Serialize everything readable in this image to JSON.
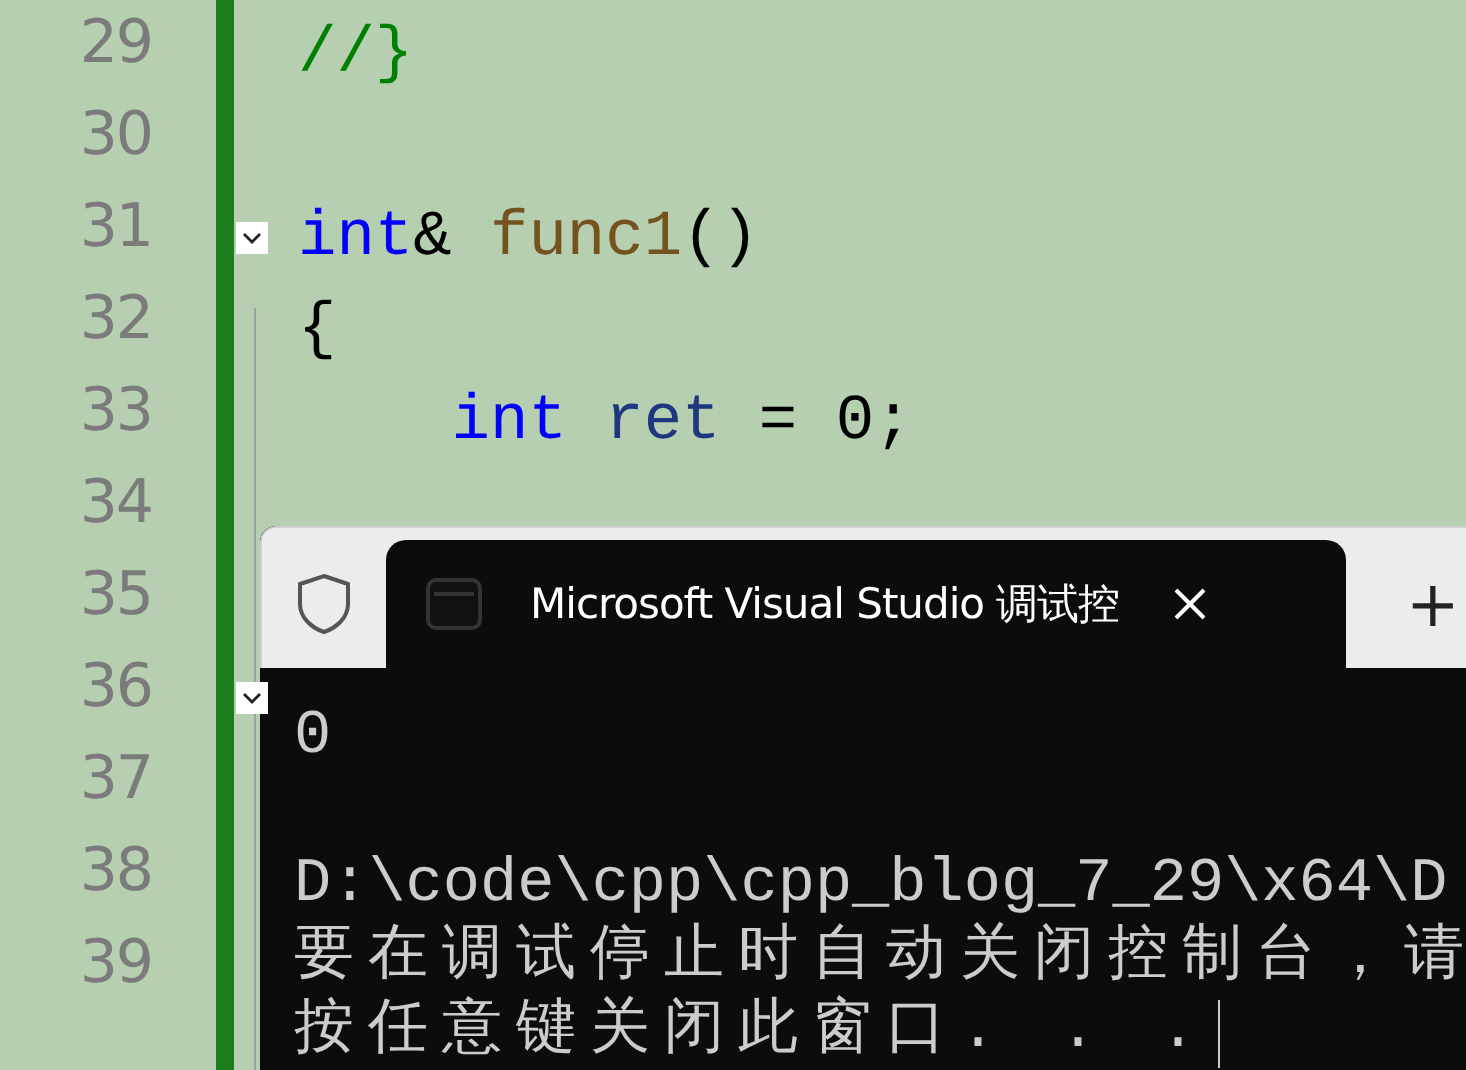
{
  "editor": {
    "lines": [
      {
        "number": "29",
        "tokens": [
          {
            "kind": "comment",
            "text": "//}"
          }
        ]
      },
      {
        "number": "30"
      },
      {
        "number": "31",
        "expanded": true,
        "tokens": [
          {
            "kind": "keyword",
            "text": "int"
          },
          {
            "kind": "plain",
            "text": "& "
          },
          {
            "kind": "function",
            "text": "func1"
          },
          {
            "kind": "plain",
            "text": "()"
          }
        ]
      },
      {
        "number": "32",
        "tokens": [
          {
            "kind": "plain",
            "text": "{"
          }
        ],
        "children": [
          {
            "number": "33",
            "tokens": [
              {
                "kind": "keyword",
                "text": "int"
              },
              {
                "kind": "variable",
                "text": " ret"
              },
              {
                "kind": "plain",
                "text": " = 0;"
              }
            ]
          },
          {
            "number": "34"
          }
        ]
      },
      {
        "number": "35"
      },
      {
        "number": "36",
        "expanded": true
      },
      {
        "number": "37"
      },
      {
        "number": "38"
      },
      {
        "number": "39"
      }
    ]
  },
  "terminal": {
    "tab": {
      "title": "Microsoft Visual Studio 调试控",
      "selected": true
    },
    "new_tab": "+",
    "lines": [
      {
        "kind": "ascii",
        "text": "0"
      },
      {
        "kind": "blank"
      },
      {
        "kind": "ascii",
        "text": "D:\\code\\cpp\\cpp_blog_7_29\\x64\\D"
      },
      {
        "kind": "cjk",
        "text": "要在调试停止时自动关闭控制台，请"
      },
      {
        "kind": "cjk",
        "text": "按任意键关闭此窗口. . .",
        "cursor": true
      }
    ]
  }
}
